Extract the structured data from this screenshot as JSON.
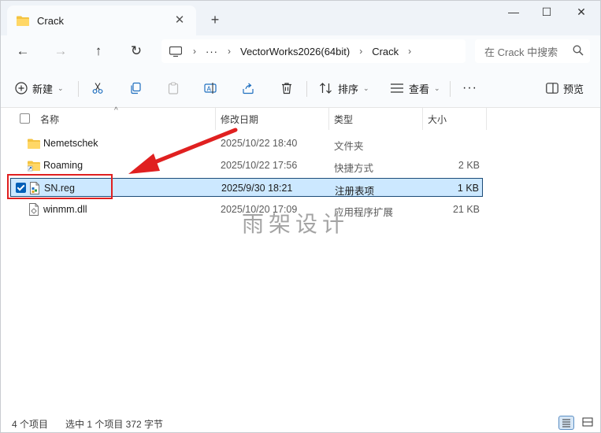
{
  "window": {
    "tab_title": "Crack",
    "tab_close": "✕",
    "new_tab": "+",
    "minimize": "—",
    "maximize": "☐",
    "close": "✕"
  },
  "nav": {
    "back": "←",
    "forward": "→",
    "up": "↑",
    "refresh": "↻"
  },
  "address": {
    "ellipsis": "···",
    "segments": [
      "VectorWorks2026(64bit)",
      "Crack"
    ],
    "separator": "›"
  },
  "search": {
    "placeholder": "在 Crack 中搜索"
  },
  "toolbar": {
    "new_label": "新建",
    "sort_label": "排序",
    "view_label": "查看",
    "more": "···",
    "preview_label": "预览"
  },
  "columns": {
    "name": "名称",
    "date": "修改日期",
    "type": "类型",
    "size": "大小"
  },
  "files": [
    {
      "name": "Nemetschek",
      "date": "2025/10/22 18:40",
      "type": "文件夹",
      "size": "",
      "icon": "folder-icon"
    },
    {
      "name": "Roaming",
      "date": "2025/10/22 17:56",
      "type": "快捷方式",
      "size": "2 KB",
      "icon": "folder-shortcut-icon"
    },
    {
      "name": "SN.reg",
      "date": "2025/9/30 18:21",
      "type": "注册表项",
      "size": "1 KB",
      "icon": "registry-file-icon",
      "selected": true
    },
    {
      "name": "winmm.dll",
      "date": "2025/10/20 17:09",
      "type": "应用程序扩展",
      "size": "21 KB",
      "icon": "dll-file-icon"
    }
  ],
  "watermark": "雨架设计",
  "status": {
    "count": "4 个项目",
    "selected": "选中 1 个项目  372 字节"
  },
  "colors": {
    "accent": "#005fb8",
    "selection": "#cce8ff",
    "highlight": "#e02020"
  }
}
